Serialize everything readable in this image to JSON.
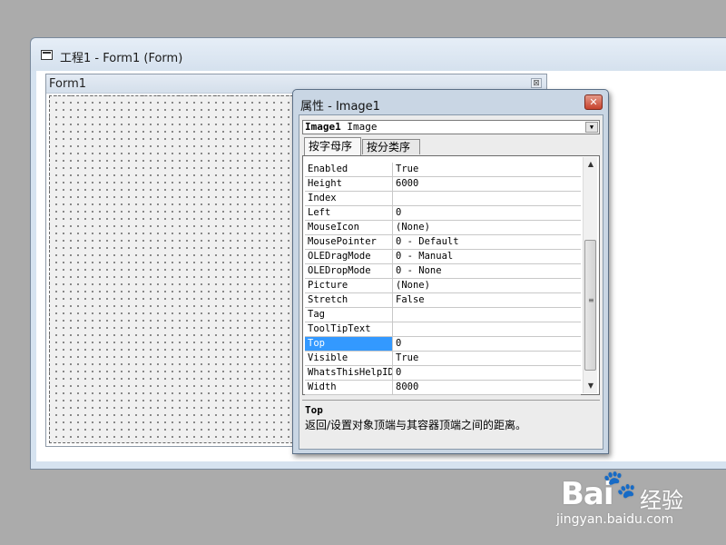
{
  "project_window": {
    "title": "工程1 - Form1 (Form)"
  },
  "form": {
    "title": "Form1",
    "close_glyph": "⊠"
  },
  "properties_window": {
    "title": "属性 - Image1",
    "close_glyph": "✕",
    "object_combo": {
      "name": "Image1",
      "type": "Image"
    },
    "tabs": [
      {
        "label": "按字母序",
        "active": true
      },
      {
        "label": "按分类序",
        "active": false
      }
    ],
    "properties": [
      {
        "name": "Enabled",
        "value": "True"
      },
      {
        "name": "Height",
        "value": "6000"
      },
      {
        "name": "Index",
        "value": ""
      },
      {
        "name": "Left",
        "value": "0"
      },
      {
        "name": "MouseIcon",
        "value": "(None)"
      },
      {
        "name": "MousePointer",
        "value": "0 - Default"
      },
      {
        "name": "OLEDragMode",
        "value": "0 - Manual"
      },
      {
        "name": "OLEDropMode",
        "value": "0 - None"
      },
      {
        "name": "Picture",
        "value": "(None)"
      },
      {
        "name": "Stretch",
        "value": "False"
      },
      {
        "name": "Tag",
        "value": ""
      },
      {
        "name": "ToolTipText",
        "value": ""
      },
      {
        "name": "Top",
        "value": "0",
        "selected": true
      },
      {
        "name": "Visible",
        "value": "True"
      },
      {
        "name": "WhatsThisHelpID",
        "value": "0"
      },
      {
        "name": "Width",
        "value": "8000"
      }
    ],
    "description": {
      "name": "Top",
      "text": "返回/设置对象顶端与其容器顶端之间的距离。"
    }
  },
  "watermark": {
    "brand": "Bai",
    "brand_cn": "经验",
    "url": "jingyan.baidu.com"
  },
  "colors": {
    "selection": "#3399ff",
    "desktop": "#ababab",
    "close_button": "#c7422c"
  }
}
